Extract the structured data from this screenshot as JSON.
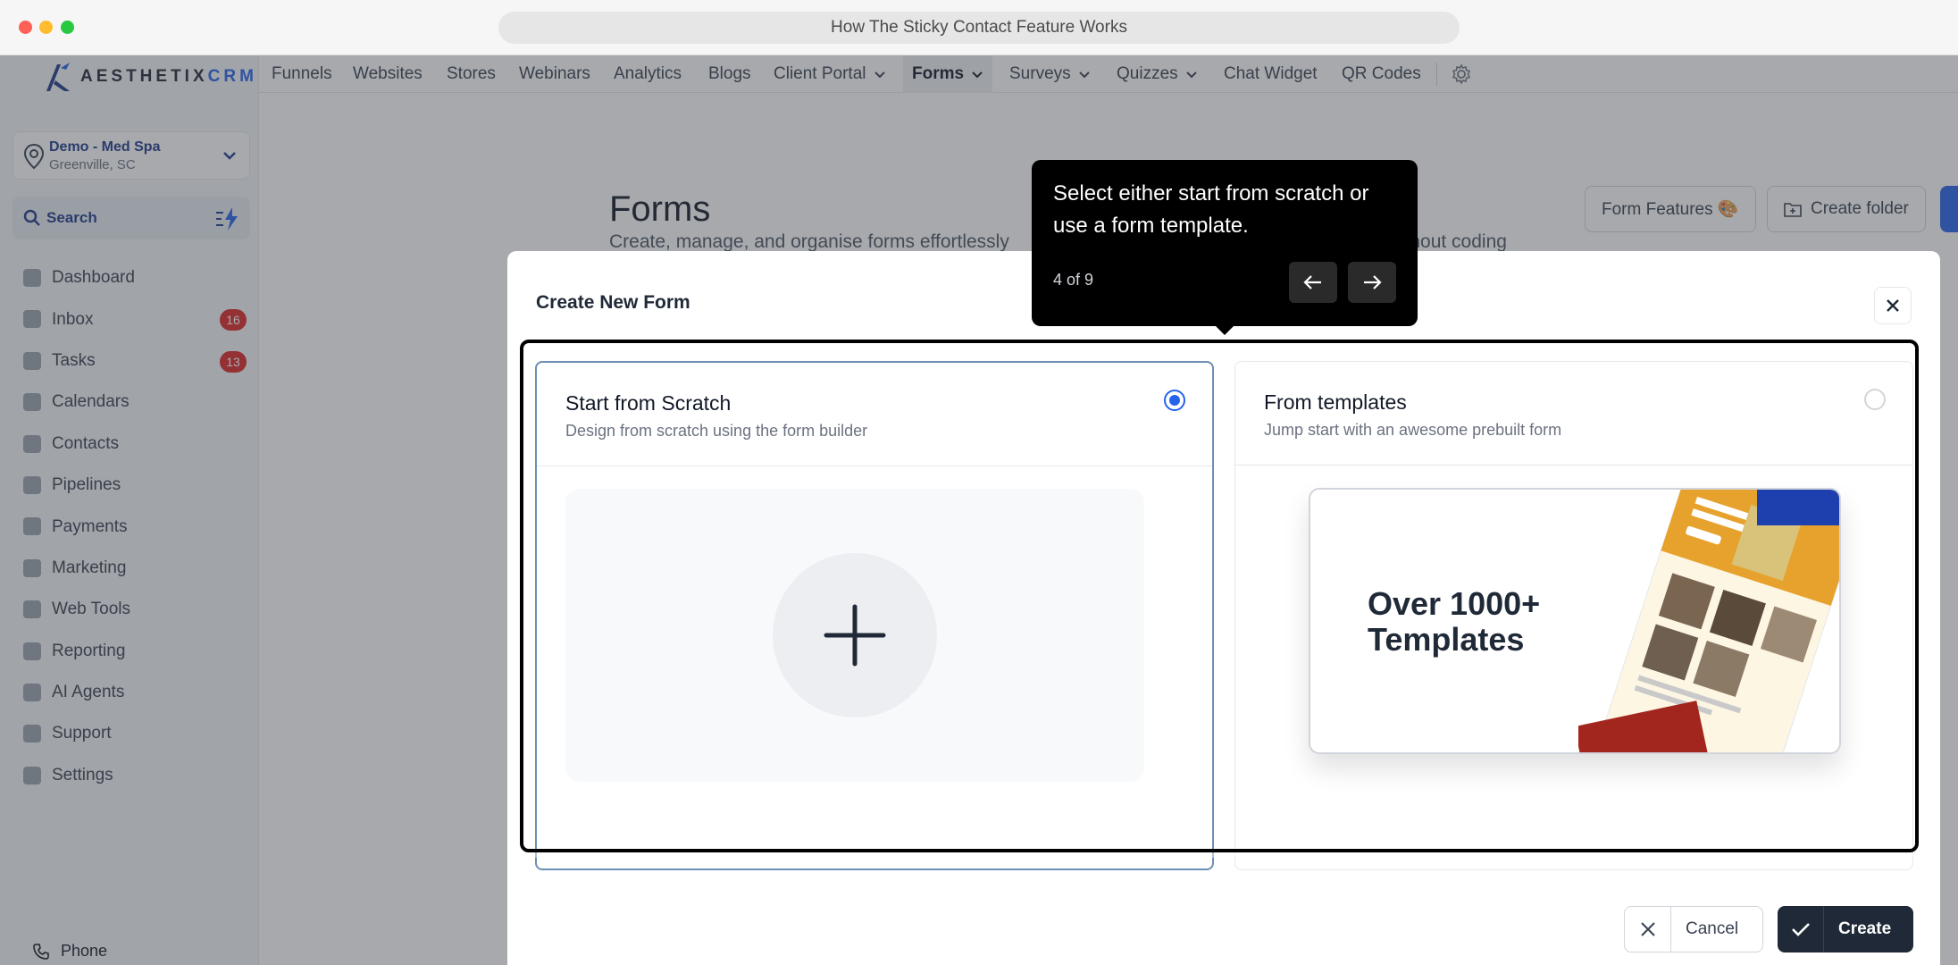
{
  "browser": {
    "title": "How The Sticky Contact Feature Works"
  },
  "sidebar": {
    "logo": {
      "text_main": "AESTHETIX",
      "text_accent": "CRM"
    },
    "location": {
      "name": "Demo - Med Spa",
      "address": "Greenville, SC"
    },
    "search": {
      "label": "Search"
    },
    "items": [
      {
        "label": "Dashboard",
        "icon": "dashboard-icon"
      },
      {
        "label": "Inbox",
        "icon": "inbox-icon",
        "badge": "16"
      },
      {
        "label": "Tasks",
        "icon": "tasks-icon",
        "badge": "13"
      },
      {
        "label": "Calendars",
        "icon": "calendar-icon"
      },
      {
        "label": "Contacts",
        "icon": "contacts-icon"
      },
      {
        "label": "Pipelines",
        "icon": "pipelines-icon"
      },
      {
        "label": "Payments",
        "icon": "payments-icon"
      },
      {
        "label": "Marketing",
        "icon": "marketing-icon"
      },
      {
        "label": "Web Tools",
        "icon": "web-tools-icon"
      },
      {
        "label": "Reporting",
        "icon": "reporting-icon"
      },
      {
        "label": "AI Agents",
        "icon": "ai-agents-icon"
      },
      {
        "label": "Support",
        "icon": "support-icon"
      },
      {
        "label": "Settings",
        "icon": "settings-icon"
      }
    ],
    "phone": "Phone"
  },
  "topnav": {
    "tabs": [
      "Funnels",
      "Websites",
      "Stores",
      "Webinars",
      "Analytics",
      "Blogs",
      "Client Portal",
      "Forms",
      "Surveys",
      "Quizzes",
      "Chat Widget",
      "QR Codes"
    ],
    "active": "Forms"
  },
  "page": {
    "title": "Forms",
    "subtitle_left": "Create, manage, and organise forms effortlessly",
    "subtitle_right": "ithout coding",
    "form_features": "Form Features 🎨",
    "create_folder": "Create folder"
  },
  "modal": {
    "title": "Create New Form",
    "scratch": {
      "title": "Start from Scratch",
      "desc": "Design from scratch using the form builder",
      "selected": true
    },
    "templates": {
      "title": "From templates",
      "desc": "Jump start with an awesome prebuilt form",
      "selected": false,
      "image_heading_1": "Over 1000+",
      "image_heading_2": "Templates"
    },
    "cancel": "Cancel",
    "create": "Create"
  },
  "tooltip": {
    "text": "Select either start from scratch or use a form template.",
    "step": "4 of 9"
  },
  "colors": {
    "accent": "#2563eb",
    "badge": "#dc2626",
    "dark": "#1f2937"
  }
}
